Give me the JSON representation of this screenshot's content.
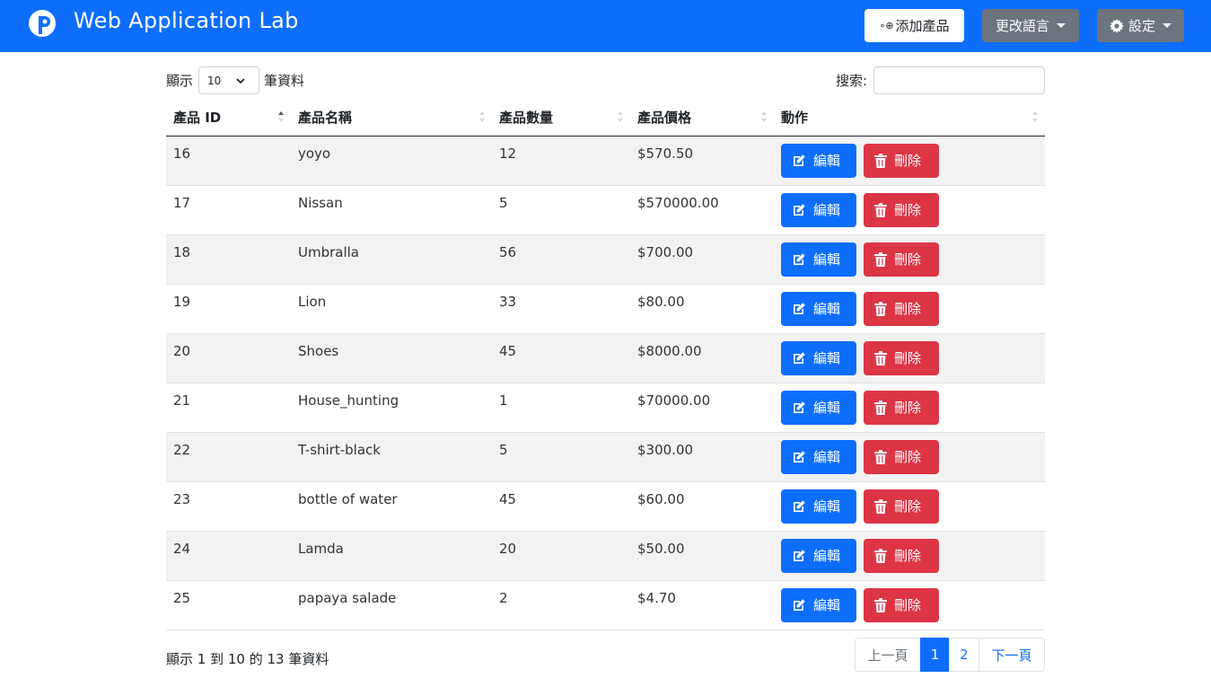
{
  "app": {
    "title": "Web Application Lab"
  },
  "nav": {
    "add_product": "添加產品",
    "change_language": "更改語言",
    "settings": "設定"
  },
  "controls": {
    "show_label": "顯示",
    "page_length": "10",
    "entries_label": "筆資料",
    "search_label": "搜索:",
    "search_value": ""
  },
  "table": {
    "columns": [
      "產品 ID",
      "產品名稱",
      "產品數量",
      "產品價格",
      "動作"
    ],
    "edit_label": "編輯",
    "delete_label": "刪除",
    "rows": [
      {
        "id": "16",
        "name": "yoyo",
        "qty": "12",
        "price": "$570.50"
      },
      {
        "id": "17",
        "name": "Nissan",
        "qty": "5",
        "price": "$570000.00"
      },
      {
        "id": "18",
        "name": "Umbralla",
        "qty": "56",
        "price": "$700.00"
      },
      {
        "id": "19",
        "name": "Lion",
        "qty": "33",
        "price": "$80.00"
      },
      {
        "id": "20",
        "name": "Shoes",
        "qty": "45",
        "price": "$8000.00"
      },
      {
        "id": "21",
        "name": "House_hunting",
        "qty": "1",
        "price": "$70000.00"
      },
      {
        "id": "22",
        "name": "T-shirt-black",
        "qty": "5",
        "price": "$300.00"
      },
      {
        "id": "23",
        "name": "bottle of water",
        "qty": "45",
        "price": "$60.00"
      },
      {
        "id": "24",
        "name": "Lamda",
        "qty": "20",
        "price": "$50.00"
      },
      {
        "id": "25",
        "name": "papaya salade",
        "qty": "2",
        "price": "$4.70"
      }
    ]
  },
  "footer": {
    "info": "顯示 1 到 10 的 13 筆資料",
    "prev": "上一頁",
    "pages": [
      "1",
      "2"
    ],
    "current_page": "1",
    "next": "下一頁"
  },
  "colors": {
    "primary": "#0d6efd",
    "secondary": "#6c757d",
    "danger": "#dc3545"
  }
}
